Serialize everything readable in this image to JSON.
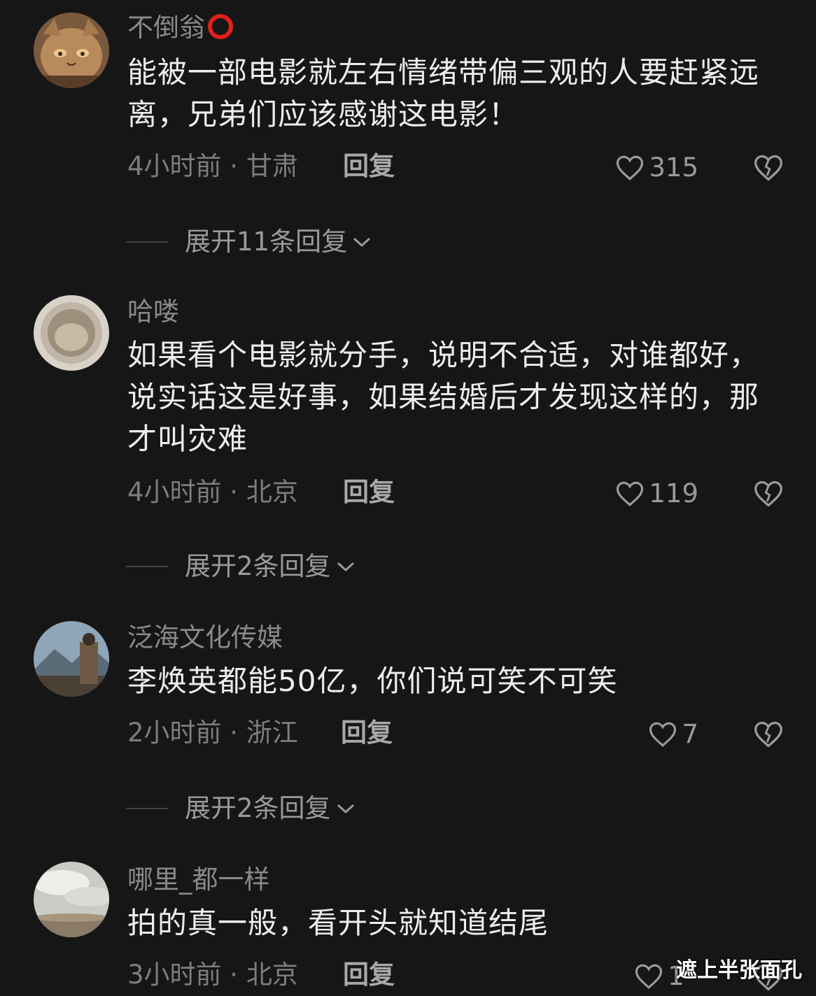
{
  "comments": [
    {
      "username": "不倒翁",
      "text": "能被一部电影就左右情绪带偏三观的人要赶紧远离，兄弟们应该感谢这电影！",
      "meta": "4小时前 · 甘肃",
      "reply_label": "回复",
      "likes": "315",
      "expand_label": "展开11条回复"
    },
    {
      "username": "哈喽",
      "text": "如果看个电影就分手，说明不合适，对谁都好，说实话这是好事，如果结婚后才发现这样的，那才叫灾难",
      "meta": "4小时前 · 北京",
      "reply_label": "回复",
      "likes": "119",
      "expand_label": "展开2条回复"
    },
    {
      "username": "泛海文化传媒",
      "text": "李焕英都能50亿，你们说可笑不可笑",
      "meta": "2小时前 · 浙江",
      "reply_label": "回复",
      "likes": "7",
      "expand_label": "展开2条回复"
    },
    {
      "username": "哪里_都一样",
      "text": "拍的真一般，看开头就知道结尾",
      "meta": "3小时前 · 北京",
      "reply_label": "回复",
      "likes": "1"
    }
  ],
  "watermark": "遮上半张面孔",
  "icons": {
    "like": "heart-outline-icon",
    "dislike": "broken-heart-icon",
    "expand": "chevron-down-icon"
  },
  "colors": {
    "background": "#161616",
    "text": "#ededed",
    "muted": "#8a8a8a",
    "badge_ring": "#e0201b"
  }
}
